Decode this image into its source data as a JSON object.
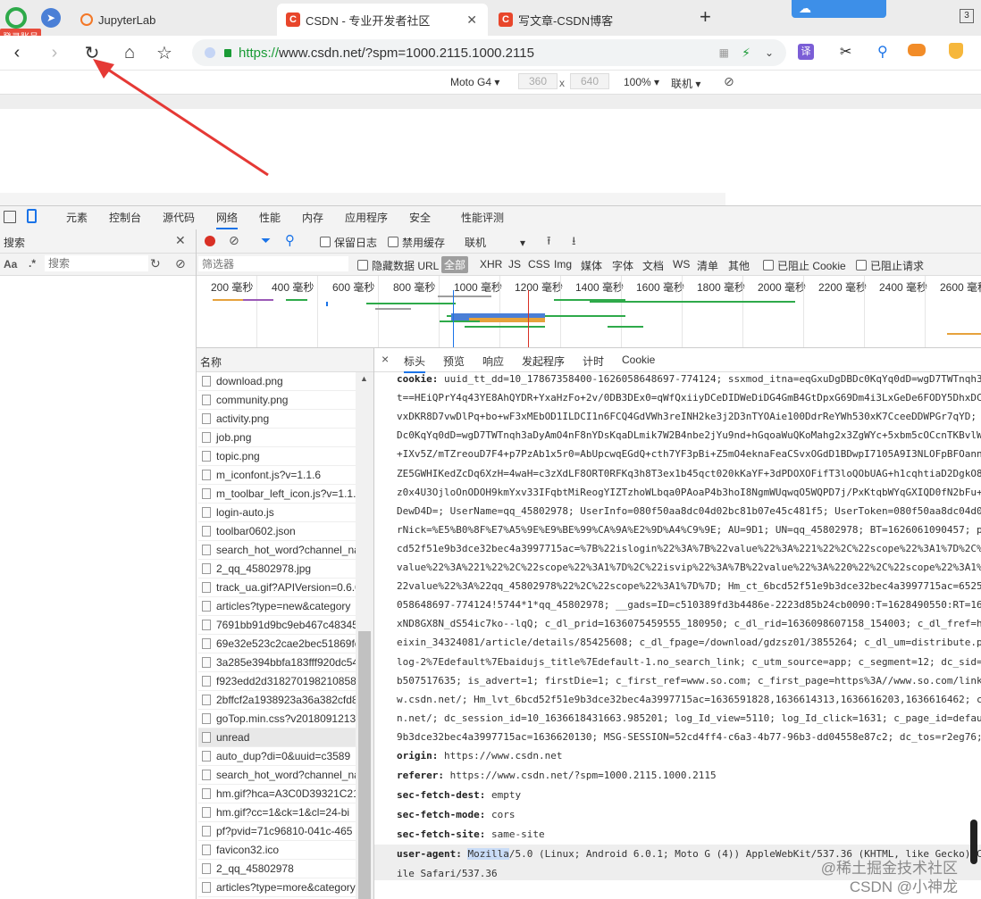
{
  "browser": {
    "tabs": [
      {
        "title": "JupyterLab",
        "active": false
      },
      {
        "title": "CSDN - 专业开发者社区",
        "active": true
      },
      {
        "title": "写文章-CSDN博客",
        "active": false
      }
    ],
    "badge": "登录账号",
    "tab_count": "3",
    "new_tab": "+",
    "url_scheme": "https://",
    "url_rest": "www.csdn.net/?spm=1000.2115.1000.2115"
  },
  "device_toolbar": {
    "device": "Moto G4",
    "width": "360",
    "height": "640",
    "times": "x",
    "zoom": "100%",
    "network": "联机"
  },
  "devtools": {
    "tabs": [
      "元素",
      "控制台",
      "源代码",
      "网络",
      "性能",
      "内存",
      "应用程序",
      "安全",
      "性能评测"
    ],
    "active_tab": "网络",
    "search_panel": {
      "title": "搜索",
      "case_label": "Aa",
      "regex_label": ".*",
      "placeholder": "搜索"
    },
    "net_toolbar": {
      "preserve_log": "保留日志",
      "disable_cache": "禁用缓存",
      "throttle": "联机"
    },
    "filter": {
      "placeholder": "筛选器",
      "hide_data_url": "隐藏数据 URL",
      "types": [
        "全部",
        "XHR",
        "JS",
        "CSS",
        "Img",
        "媒体",
        "字体",
        "文档",
        "WS",
        "清单",
        "其他"
      ],
      "blocked_cookies": "已阻止 Cookie",
      "blocked_requests": "已阻止请求"
    },
    "timeline_ticks": [
      "200 毫秒",
      "400 毫秒",
      "600 毫秒",
      "800 毫秒",
      "1000 毫秒",
      "1200 毫秒",
      "1400 毫秒",
      "1600 毫秒",
      "1800 毫秒",
      "2000 毫秒",
      "2200 毫秒",
      "2400 毫秒",
      "2600 毫秒"
    ],
    "name_header": "名称",
    "files": [
      "download.png",
      "community.png",
      "activity.png",
      "job.png",
      "topic.png",
      "m_iconfont.js?v=1.1.6",
      "m_toolbar_left_icon.js?v=1.1.6",
      "login-auto.js",
      "toolbar0602.json",
      "search_hot_word?channel_na",
      "2_qq_45802978.jpg",
      "track_ua.gif?APIVersion=0.6.0",
      "articles?type=new&category",
      "7691bb91d9bc9eb467c48345",
      "69e32e523c2cae2bec51869fc",
      "3a285e394bbfa183fff920dc54",
      "f923edd2d318270198210858",
      "2bffcf2a1938923a36a382cfd8",
      "goTop.min.css?v2018091213",
      "unread",
      "auto_dup?di=0&uuid=c3589",
      "search_hot_word?channel_na",
      "hm.gif?hca=A3C0D39321C21",
      "hm.gif?cc=1&ck=1&cl=24-bi",
      "pf?pvid=71c96810-041c-465",
      "favicon32.ico",
      "2_qq_45802978",
      "articles?type=more&category"
    ],
    "selected_file": "unread",
    "detail_tabs": [
      "标头",
      "预览",
      "响应",
      "发起程序",
      "计时",
      "Cookie"
    ],
    "detail_close": "×",
    "cookie_lines": [
      "uuid_tt_dd=10_17867358400-1626058648697-774124; ssxmod_itna=eqGxuDgDBDc0KqYq0dD=wgD7TWTnqh3a",
      "t==HEiQPrY4q43YE8AhQYDR+YxaHzFo+2v/0DB3DEx0=qWfQxiiyDCeDIDWeDiDG4GmB4GtDpxG69Dm4i3LxGeDe6FODY5DhxDC",
      "vxDKR8D7vwDlPq+bo+wF3xMEbOD1ILDCI1n6FCQ4GdVWh3reINH2ke3j2D3nTYOAie100DdrReYWh530xK7CceeDDWPGr7qYD;",
      "Dc0KqYq0dD=wgD7TWTnqh3aDyAmO4nF8nYDsKqaDLmik7W2B4nbe2jYu9nd+hGqoaWuQKoMahg2x3ZgWYc+5xbm5cOCcnTKBvlW",
      "+IXv5Z/mTZreouD7F4+p7PzAb1x5r0=AbUpcwqEGdQ+cth7YF3pBi+Z5mO4eknaFeaCSvxOGdD1BDwpI7105A9I3NLOFpBFOann",
      "ZE5GWHIKedZcDq6XzH=4waH=c3zXdLF8ORT0RFKq3h8T3ex1b45qct020kKaYF+3dPDOXOFifT3loQObUAG+h1cqhtiaD2DgkO8",
      "z0x4U3OjloOnODOH9kmYxv33IFqbtMiReogYIZTzhoWLbqa0PAoaP4b3hoI8NgmWUqwqO5WQPD7j/PxKtqbWYqGXIQD0fN2bFu+",
      "DewD4D=; UserName=qq_45802978; UserInfo=080f50aa8dc04d02bc81b07e45c481f5; UserToken=080f50aa8dc04d0",
      "rNick=%E5%B0%8F%E7%A5%9E%E9%BE%99%CA%9A%E2%9D%A4%C9%9E; AU=9D1; UN=qq_45802978; BT=1626061090457; p",
      "cd52f51e9b3dce32bec4a3997715ac=%7B%22islogin%22%3A%7B%22value%22%3A%221%22%2C%22scope%22%3A1%7D%2C%",
      "value%22%3A%221%22%2C%22scope%22%3A1%7D%2C%22isvip%22%3A%7B%22value%22%3A%220%22%2C%22scope%22%3A1%",
      "22value%22%3A%22qq_45802978%22%2C%22scope%22%3A1%7D%7D; Hm_ct_6bcd52f51e9b3dce32bec4a3997715ac=6525",
      "058648697-774124!5744*1*qq_45802978; __gads=ID=c510389fd3b4486e-2223d85b24cb0090:T=1628490550:RT=16",
      "xND8GX8N_dS54ic7ko--lqQ; c_dl_prid=1636075459555_180950; c_dl_rid=1636098607158_154003; c_dl_fref=h",
      "eixin_34324081/article/details/85425608; c_dl_fpage=/download/gdzsz01/3855264; c_dl_um=distribute.p",
      "log-2%7Edefault%7Ebaidujs_title%7Edefault-1.no_search_link; c_utm_source=app; c_segment=12; dc_sid=",
      "b507517635; is_advert=1; firstDie=1; c_first_ref=www.so.com; c_first_page=https%3A//www.so.com/link; c_fi",
      "w.csdn.net/; Hm_lvt_6bcd52f51e9b3dce32bec4a3997715ac=1636591828,1636614313,1636616203,1636616462; c",
      "n.net/; dc_session_id=10_1636618431663.985201; log_Id_view=5110; log_Id_click=1631; c_page_id=defau",
      "9b3dce32bec4a3997715ac=1636620130; MSG-SESSION=52cd4ff4-c6a3-4b77-96b3-dd04558e87c2; dc_tos=r2eg76;"
    ],
    "headers": [
      {
        "name": "origin:",
        "value": "https://www.csdn.net"
      },
      {
        "name": "referer:",
        "value": "https://www.csdn.net/?spm=1000.2115.1000.2115"
      },
      {
        "name": "sec-fetch-dest:",
        "value": "empty"
      },
      {
        "name": "sec-fetch-mode:",
        "value": "cors"
      },
      {
        "name": "sec-fetch-site:",
        "value": "same-site"
      }
    ],
    "cookie_label": "cookie:",
    "ua_label": "user-agent:",
    "ua_highlight": "Mozilla",
    "ua_rest": "/5.0 (Linux; Android 6.0.1; Moto G (4)) AppleWebKit/537.36 (KHTML, like Gecko) C",
    "ua_line2": "ile Safari/537.36"
  },
  "watermark": {
    "line1": "@稀土掘金技术社区",
    "line2": "CSDN @小神龙"
  },
  "colors": {
    "accent": "#1a73e8",
    "annotation_arrow": "#e53935",
    "record": "#d93025",
    "url_green": "#1a9b36"
  }
}
